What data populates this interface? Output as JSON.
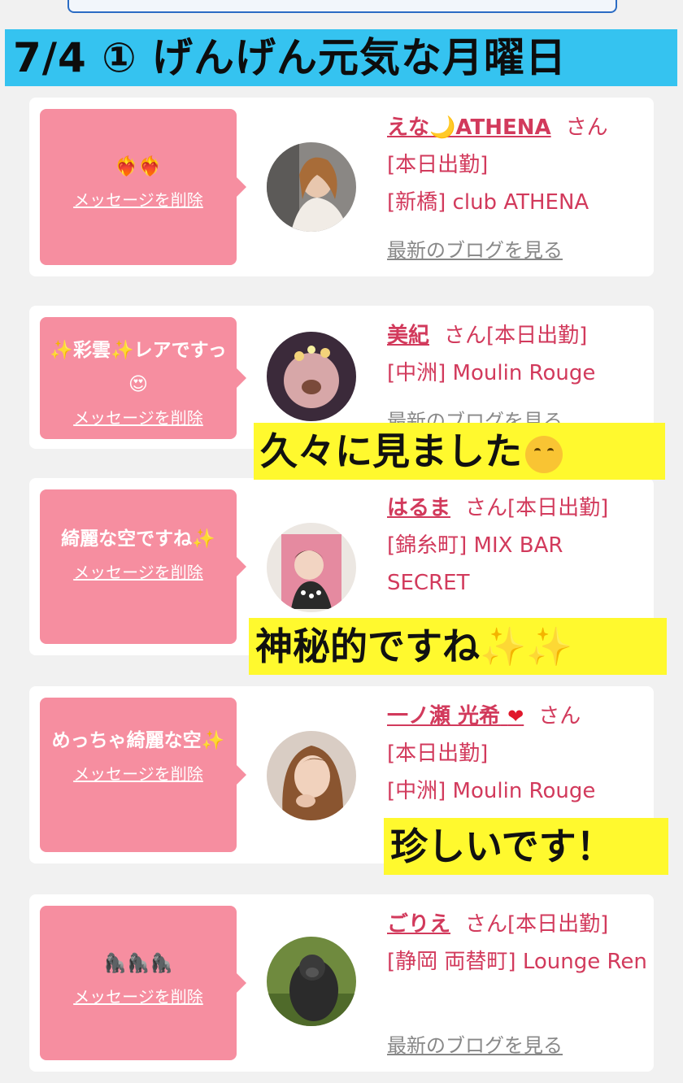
{
  "banner": {
    "title": "7/4 ① げんげん元気な月曜日"
  },
  "delete_label": "メッセージを削除",
  "blog_label": "最新のブログを見る",
  "san": "さん",
  "cards": [
    {
      "message": "❤️‍🔥❤️‍🔥",
      "name": "えな🌙ATHENA",
      "status": "[本日出勤]",
      "shop": "[新橋] club ATHENA"
    },
    {
      "message": "✨彩雲✨レアですっ😍",
      "name": "美紀",
      "status": "[本日出勤]",
      "shop": "[中洲] Moulin Rouge"
    },
    {
      "message": "綺麗な空ですね✨",
      "name": "はるま",
      "status": "[本日出勤]",
      "shop": "[錦糸町] MIX BAR SECRET"
    },
    {
      "message": "めっちゃ綺麗な空✨",
      "name": "一ノ瀬 光希",
      "status": "[本日出勤]",
      "shop": "[中洲] Moulin Rouge"
    },
    {
      "message": "🦍🦍🦍",
      "name": "ごりえ",
      "status": "[本日出勤]",
      "shop": "[静岡 両替町] Lounge Ren"
    }
  ],
  "captions": {
    "c1": "久々に見ました",
    "c2": "神秘的ですね✨✨",
    "c3": "珍しいです！"
  },
  "colors": {
    "banner": "#35c3f0",
    "bubble": "#f68ea0",
    "name": "#d23a5c",
    "caption": "#fff92e"
  }
}
